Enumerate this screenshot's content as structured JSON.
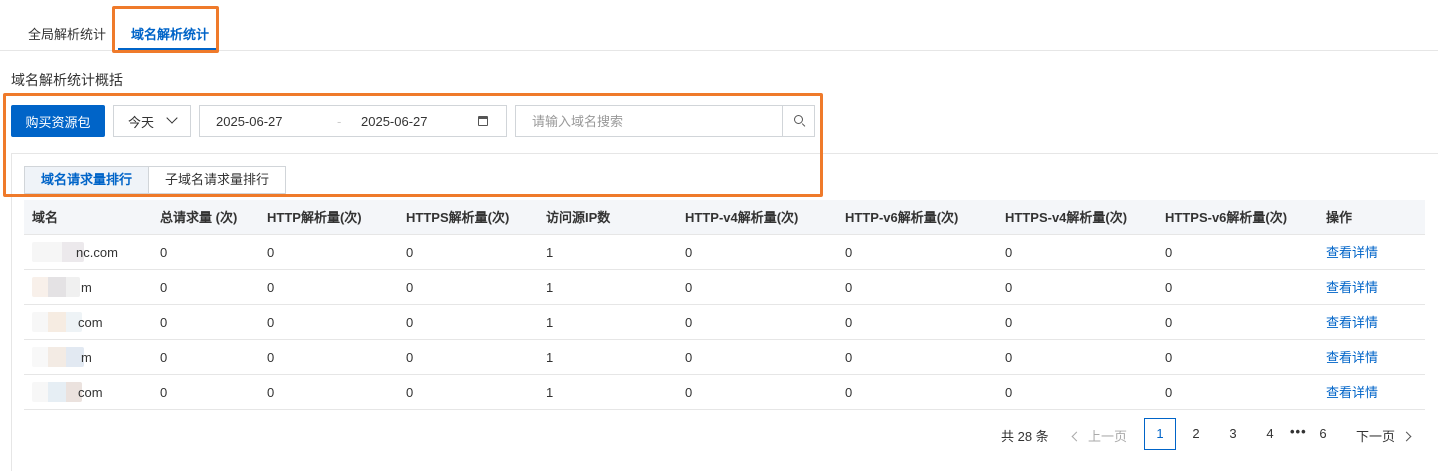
{
  "top_tabs": [
    {
      "label": "全局解析统计",
      "active": false
    },
    {
      "label": "域名解析统计",
      "active": true
    }
  ],
  "section_title": "域名解析统计概括",
  "toolbar": {
    "buy_label": "购买资源包",
    "period": "今天",
    "date_start": "2025-06-27",
    "date_separator": "-",
    "date_end": "2025-06-27",
    "search_placeholder": "请输入域名搜索"
  },
  "sub_tabs": [
    {
      "label": "域名请求量排行",
      "active": true
    },
    {
      "label": "子域名请求量排行",
      "active": false
    }
  ],
  "table": {
    "headers": [
      "域名",
      "总请求量 (次)",
      "HTTP解析量(次)",
      "HTTPS解析量(次)",
      "访问源IP数",
      "HTTP-v4解析量(次)",
      "HTTP-v6解析量(次)",
      "HTTPS-v4解析量(次)",
      "HTTPS-v6解析量(次)",
      "操作"
    ],
    "rows": [
      {
        "domain": "nc.com",
        "total": "0",
        "http": "0",
        "https": "0",
        "ips": "1",
        "http_v4": "0",
        "http_v6": "0",
        "https_v4": "0",
        "https_v6": "0",
        "action": "查看详情"
      },
      {
        "domain": "m",
        "total": "0",
        "http": "0",
        "https": "0",
        "ips": "1",
        "http_v4": "0",
        "http_v6": "0",
        "https_v4": "0",
        "https_v6": "0",
        "action": "查看详情"
      },
      {
        "domain": "com",
        "total": "0",
        "http": "0",
        "https": "0",
        "ips": "1",
        "http_v4": "0",
        "http_v6": "0",
        "https_v4": "0",
        "https_v6": "0",
        "action": "查看详情"
      },
      {
        "domain": "m",
        "total": "0",
        "http": "0",
        "https": "0",
        "ips": "1",
        "http_v4": "0",
        "http_v6": "0",
        "https_v4": "0",
        "https_v6": "0",
        "action": "查看详情"
      },
      {
        "domain": "com",
        "total": "0",
        "http": "0",
        "https": "0",
        "ips": "1",
        "http_v4": "0",
        "http_v6": "0",
        "https_v4": "0",
        "https_v6": "0",
        "action": "查看详情"
      }
    ]
  },
  "pagination": {
    "total": "共 28 条",
    "prev": "上一页",
    "pages": [
      "1",
      "2",
      "3",
      "4",
      "6"
    ],
    "current": "1",
    "ellipsis": "•••",
    "next": "下一页"
  },
  "colors": {
    "accent": "#0064c8",
    "highlight": "#ef7a2a"
  },
  "icons": [
    "chevron-down-icon",
    "calendar-icon",
    "search-icon",
    "chevron-left-icon",
    "chevron-right-icon"
  ]
}
